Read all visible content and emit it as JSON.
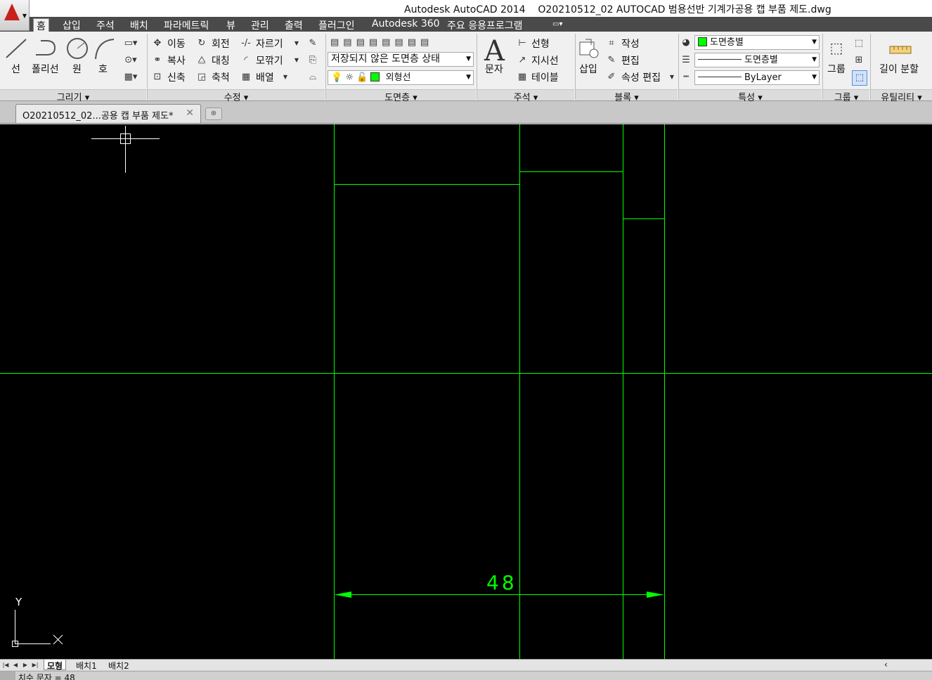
{
  "app_title": "Autodesk AutoCAD 2014",
  "document_title": "O20210512_02 AUTOCAD 범용선반 기계가공용 캡 부품 제도.dwg",
  "menu_tabs": [
    "홈",
    "삽입",
    "주석",
    "배치",
    "파라메트릭",
    "뷰",
    "관리",
    "출력",
    "플러그인",
    "Autodesk 360",
    "주요 응용프로그램"
  ],
  "draw_panel": {
    "title": "그리기",
    "line": "선",
    "polyline": "폴리선",
    "circle": "원",
    "arc": "호"
  },
  "modify_panel": {
    "title": "수정",
    "move": "이동",
    "rotate": "회전",
    "trim": "자르기",
    "copy": "복사",
    "mirror": "대칭",
    "fillet": "모깎기",
    "stretch": "신축",
    "scale": "축척",
    "array": "배열"
  },
  "layers_panel": {
    "title": "도면층",
    "layer_state": "저장되지 않은 도면층 상태",
    "current_layer": "외형선"
  },
  "annotation_panel": {
    "title": "주석",
    "text": "문자",
    "linear": "선형",
    "leader": "지시선",
    "table": "테이블"
  },
  "block_panel": {
    "title": "블록",
    "insert": "삽입",
    "create": "작성",
    "edit": "편집",
    "edit_attributes": "속성 편집"
  },
  "properties_panel": {
    "title": "특성",
    "color": "도면층별",
    "lineweight": "도면층별",
    "linetype": "ByLayer"
  },
  "groups_panel": {
    "title": "그룹",
    "group": "그룹"
  },
  "utilities_panel": {
    "title": "유틸리티",
    "measure": "길이 분할"
  },
  "document_tab": "O20210512_02...공용 캡 부품 제도*",
  "drawing": {
    "dimension_text": "48",
    "line_color": "#00ff00",
    "background": "#000000"
  },
  "ucs": {
    "x_label": "X",
    "y_label": "Y"
  },
  "layout_tabs": [
    "모형",
    "배치1",
    "배치2"
  ],
  "command_line": "치수 문자 = 48"
}
